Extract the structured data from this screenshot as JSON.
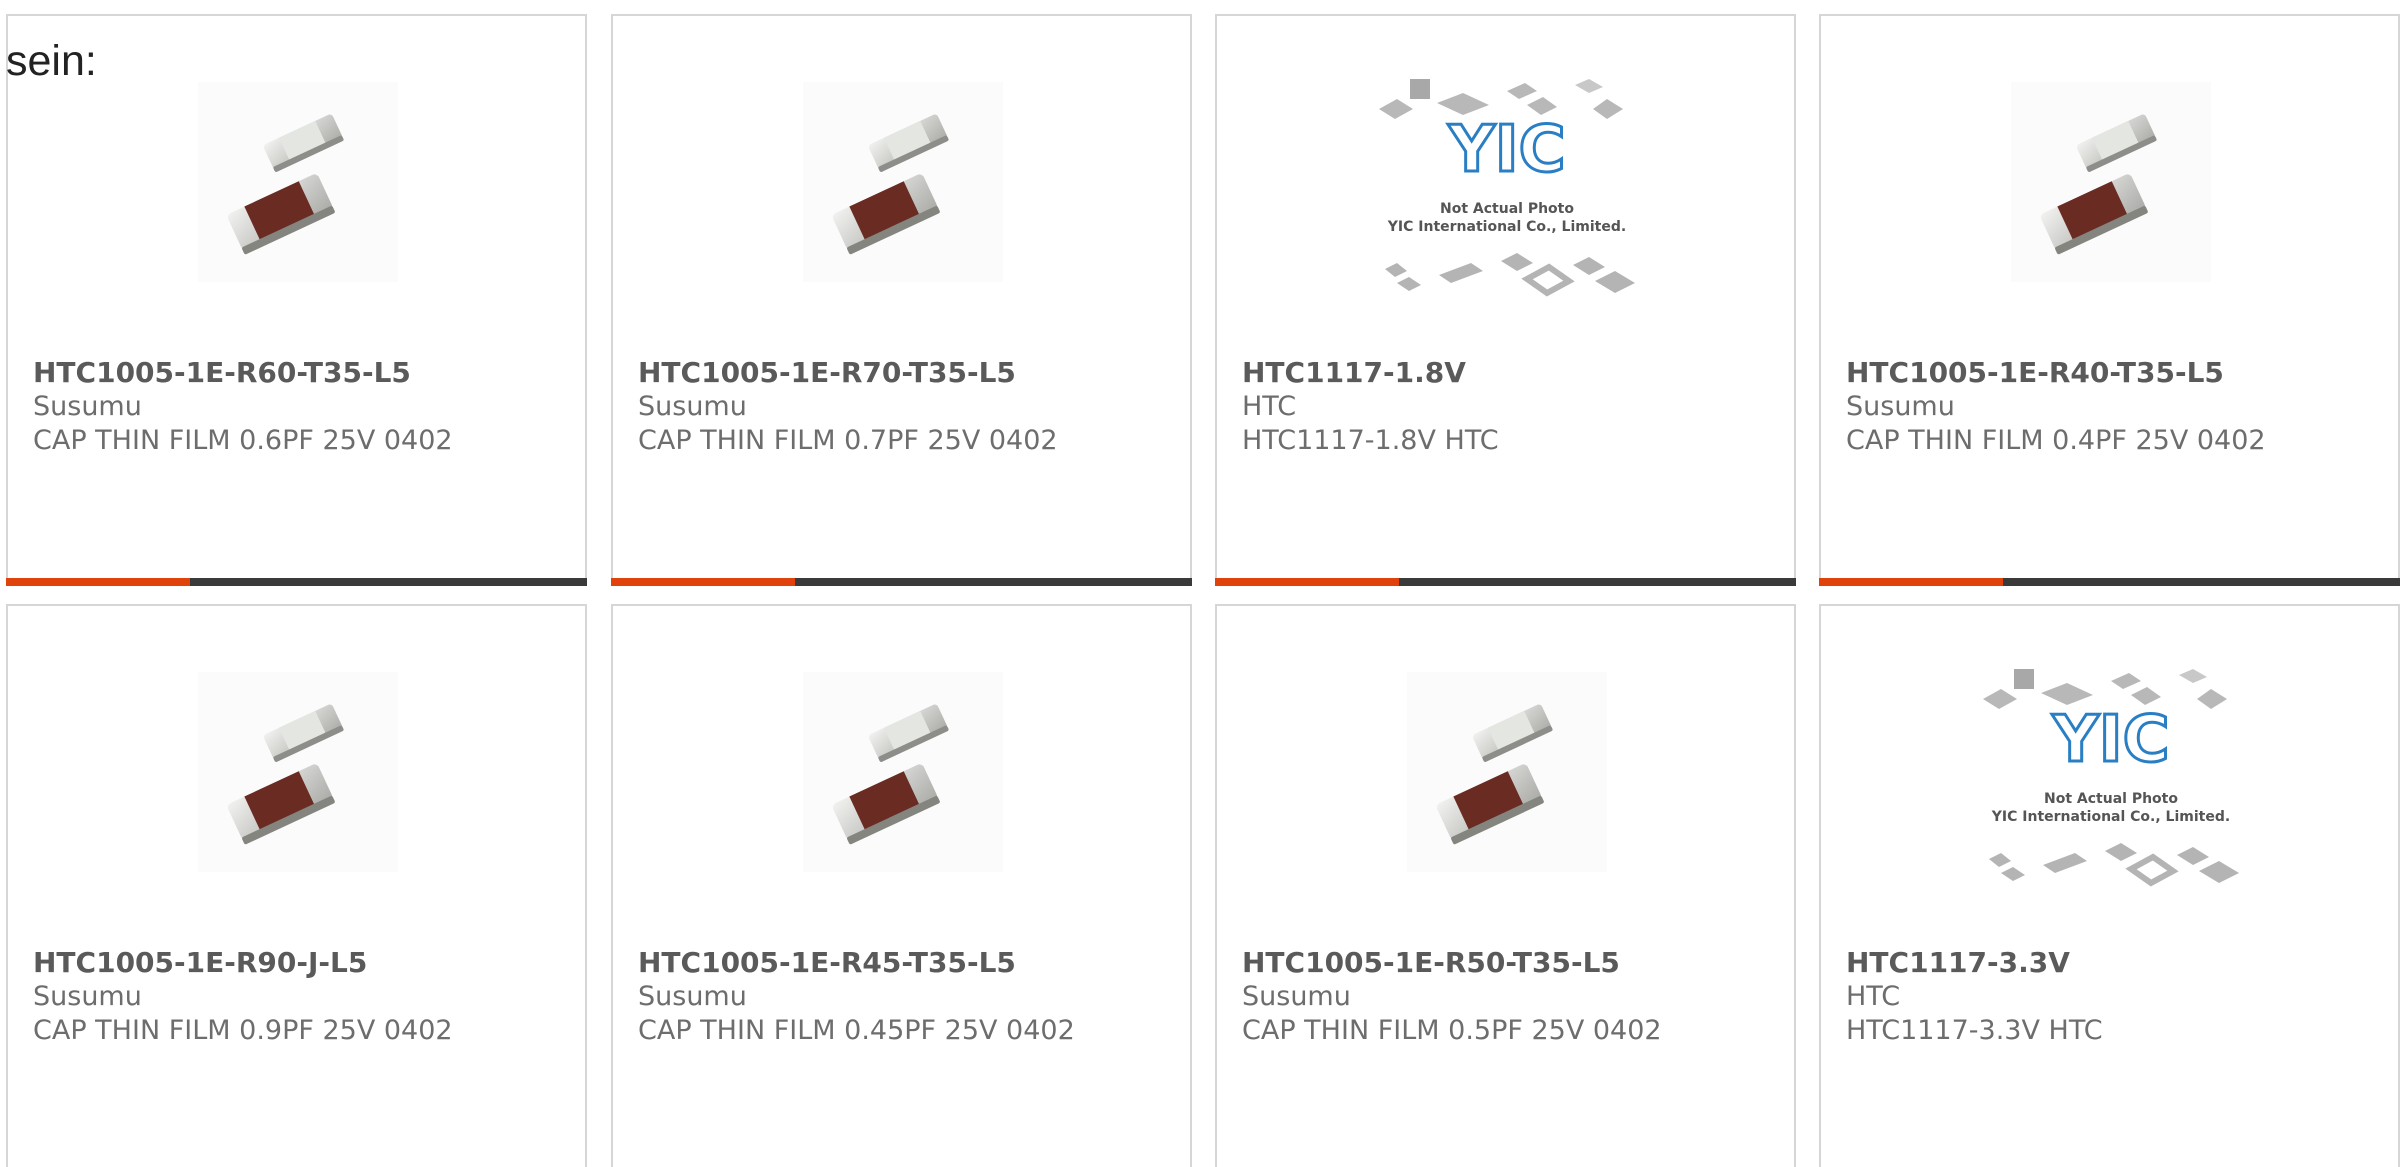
{
  "intro_text": "sein:",
  "accent_color": "#e0420b",
  "bar_color": "#3a3a3a",
  "products": [
    {
      "part": "HTC1005-1E-R60-T35-L5",
      "manufacturer": "Susumu",
      "description": "CAP THIN FILM 0.6PF 25V 0402",
      "image": "capacitor-chip-image"
    },
    {
      "part": "HTC1005-1E-R70-T35-L5",
      "manufacturer": "Susumu",
      "description": "CAP THIN FILM 0.7PF 25V 0402",
      "image": "capacitor-chip-image"
    },
    {
      "part": "HTC1117-1.8V",
      "manufacturer": "HTC",
      "description": "HTC1117-1.8V HTC",
      "image": "yic-placeholder-image",
      "image_caption_1": "Not Actual Photo",
      "image_caption_2": "YIC International Co., Limited.",
      "image_logo": "YIC"
    },
    {
      "part": "HTC1005-1E-R40-T35-L5",
      "manufacturer": "Susumu",
      "description": "CAP THIN FILM 0.4PF 25V 0402",
      "image": "capacitor-chip-image"
    },
    {
      "part": "HTC1005-1E-R90-J-L5",
      "manufacturer": "Susumu",
      "description": "CAP THIN FILM 0.9PF 25V 0402",
      "image": "capacitor-chip-image"
    },
    {
      "part": "HTC1005-1E-R45-T35-L5",
      "manufacturer": "Susumu",
      "description": "CAP THIN FILM 0.45PF 25V 0402",
      "image": "capacitor-chip-image"
    },
    {
      "part": "HTC1005-1E-R50-T35-L5",
      "manufacturer": "Susumu",
      "description": "CAP THIN FILM 0.5PF 25V 0402",
      "image": "capacitor-chip-image"
    },
    {
      "part": "HTC1117-3.3V",
      "manufacturer": "HTC",
      "description": "HTC1117-3.3V HTC",
      "image": "yic-placeholder-image",
      "image_caption_1": "Not Actual Photo",
      "image_caption_2": "YIC International Co., Limited.",
      "image_logo": "YIC"
    }
  ]
}
